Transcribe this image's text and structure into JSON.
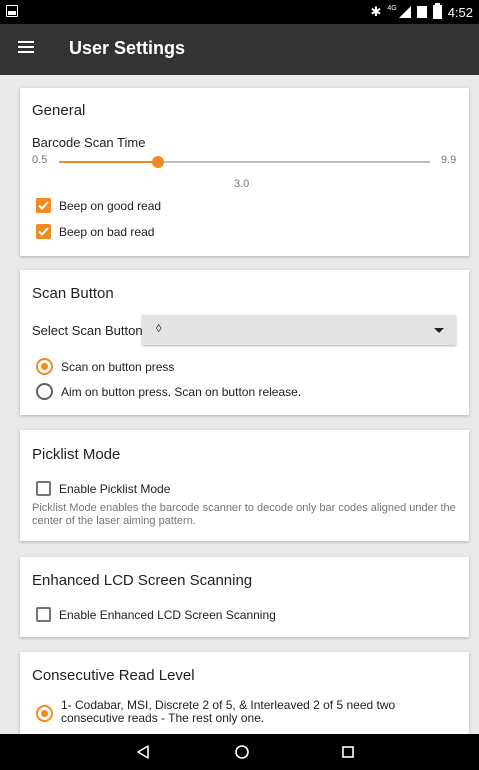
{
  "status_bar": {
    "time": "4:52",
    "network_label": "4G",
    "bluetooth_glyph": "✱",
    "icons": [
      "image-icon",
      "bluetooth-icon",
      "signal-icon",
      "battery-icon"
    ]
  },
  "app_bar": {
    "title": "User Settings",
    "menu_icon": "hamburger-menu-icon"
  },
  "general": {
    "title": "General",
    "scan_time_label": "Barcode Scan Time",
    "slider_min": "0.5",
    "slider_max": "9.9",
    "slider_value": "3.0",
    "slider_value_num": 3.0,
    "slider_min_num": 0.5,
    "slider_max_num": 9.9,
    "beep_good_label": "Beep on good read",
    "beep_good_checked": true,
    "beep_bad_label": "Beep on bad read",
    "beep_bad_checked": true
  },
  "scan_button": {
    "title": "Scan Button",
    "select_label": "Select Scan Button:",
    "select_value": "◊",
    "options": [
      {
        "label": "Scan on button press",
        "selected": true
      },
      {
        "label": "Aim on button press. Scan on button release.",
        "selected": false
      }
    ]
  },
  "picklist": {
    "title": "Picklist Mode",
    "checkbox_label": "Enable Picklist Mode",
    "checked": false,
    "description": "Picklist Mode enables the barcode scanner to decode only bar codes aligned under the center of the laser aiming pattern."
  },
  "enhanced_lcd": {
    "title": "Enhanced LCD Screen Scanning",
    "checkbox_label": "Enable Enhanced LCD Screen Scanning",
    "checked": false
  },
  "consecutive": {
    "title": "Consecutive Read Level",
    "option1": "1- Codabar, MSI, Discrete 2 of 5, & Interleaved 2 of 5 need two consecutive reads - The rest only one.",
    "option1_selected": true
  },
  "nav_bar": {
    "back": "back-icon",
    "home": "home-icon",
    "recents": "recents-icon"
  },
  "colors": {
    "accent": "#f28a1e",
    "app_bar": "#333333",
    "background": "#e9e9e9"
  }
}
